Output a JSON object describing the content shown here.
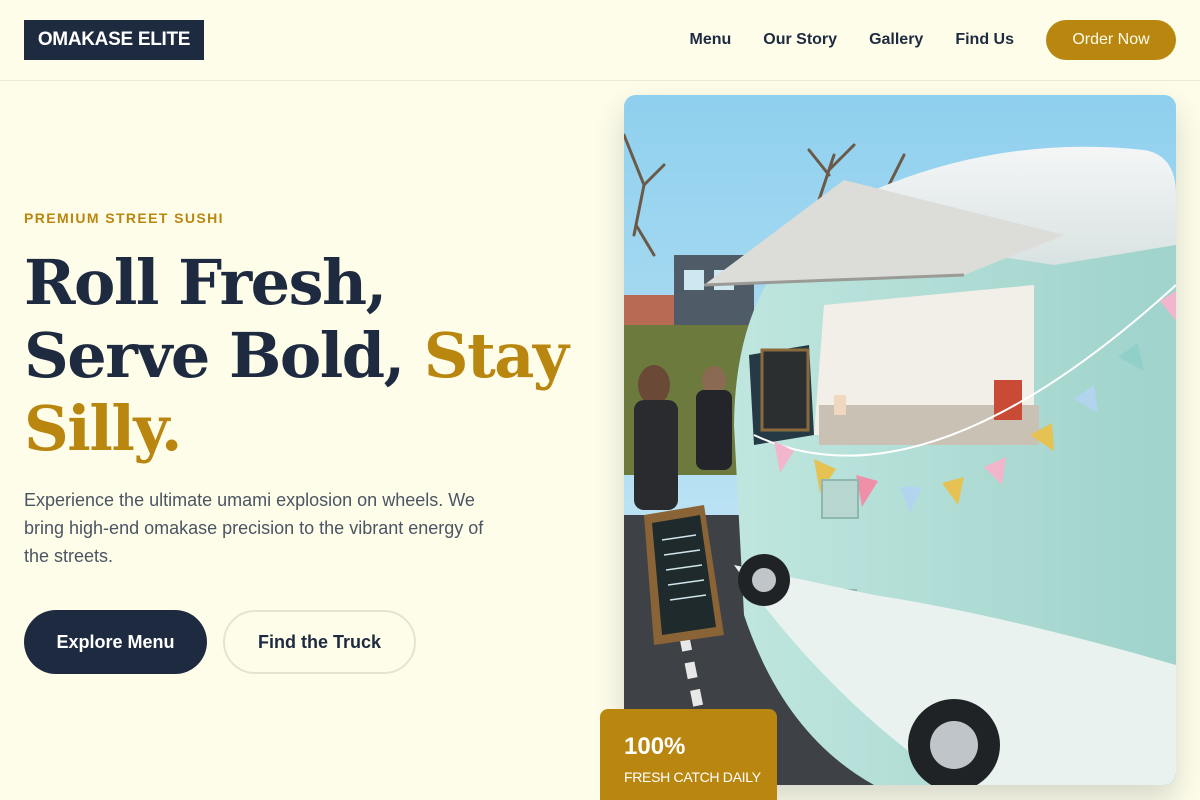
{
  "header": {
    "logo": "OMAKASE ELITE",
    "nav": [
      {
        "label": "Menu"
      },
      {
        "label": "Our Story"
      },
      {
        "label": "Gallery"
      },
      {
        "label": "Find Us"
      }
    ],
    "cta_label": "Order Now"
  },
  "hero": {
    "eyebrow": "PREMIUM STREET SUSHI",
    "headline_line1": "Roll Fresh,",
    "headline_line2": "Serve Bold,",
    "headline_accent_1": "Stay",
    "headline_accent_2": "Silly.",
    "description": "Experience the ultimate umami explosion on wheels. We bring high-end omakase precision to the vibrant energy of the streets.",
    "primary_button": "Explore Menu",
    "secondary_button": "Find the Truck"
  },
  "stat": {
    "value": "100%",
    "label": "FRESH CATCH DAILY"
  },
  "colors": {
    "background": "#fefde9",
    "navy": "#1e2a40",
    "gold": "#b98710",
    "body_text": "#4b5563"
  }
}
